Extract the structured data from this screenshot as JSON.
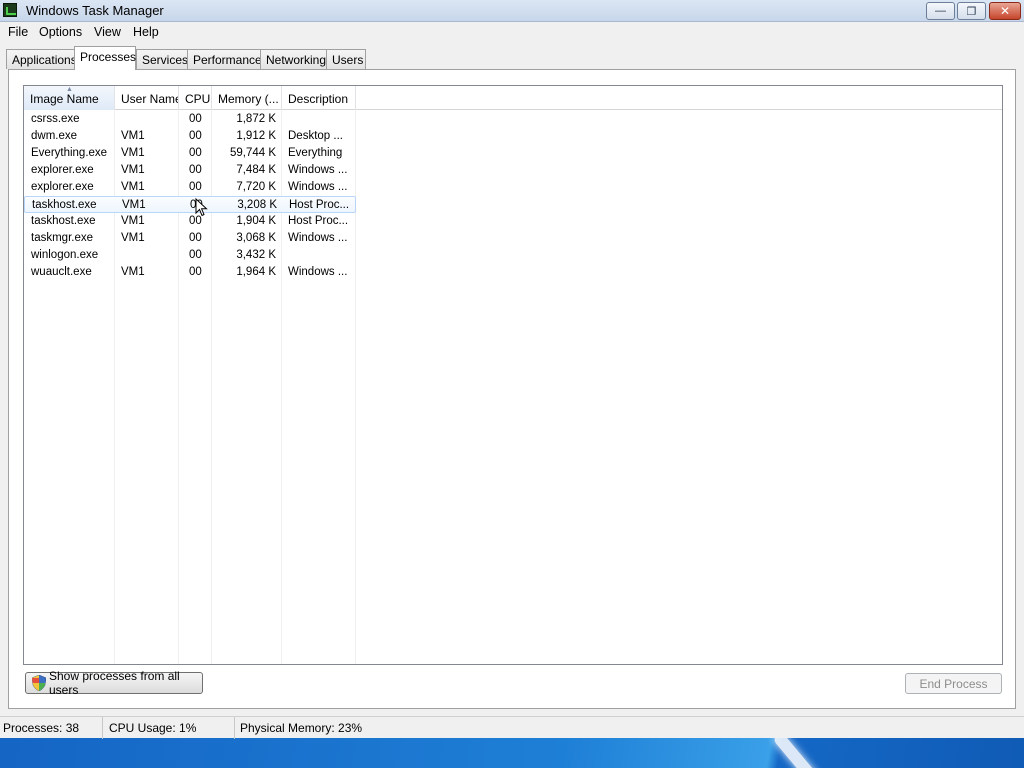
{
  "window": {
    "title": "Windows Task Manager",
    "buttons": {
      "minimize": "—",
      "maximize": "❐",
      "close": "✕"
    }
  },
  "menu": [
    "File",
    "Options",
    "View",
    "Help"
  ],
  "tabs": [
    "Applications",
    "Processes",
    "Services",
    "Performance",
    "Networking",
    "Users"
  ],
  "active_tab": "Processes",
  "table": {
    "columns": [
      "Image Name",
      "User Name",
      "CPU",
      "Memory (...",
      "Description"
    ],
    "rows": [
      {
        "name": "csrss.exe",
        "user": "",
        "cpu": "00",
        "memory": "1,872 K",
        "desc": ""
      },
      {
        "name": "dwm.exe",
        "user": "VM1",
        "cpu": "00",
        "memory": "1,912 K",
        "desc": "Desktop ..."
      },
      {
        "name": "Everything.exe",
        "user": "VM1",
        "cpu": "00",
        "memory": "59,744 K",
        "desc": "Everything"
      },
      {
        "name": "explorer.exe",
        "user": "VM1",
        "cpu": "00",
        "memory": "7,484 K",
        "desc": "Windows ..."
      },
      {
        "name": "explorer.exe",
        "user": "VM1",
        "cpu": "00",
        "memory": "7,720 K",
        "desc": "Windows ..."
      },
      {
        "name": "taskhost.exe",
        "user": "VM1",
        "cpu": "00",
        "memory": "3,208 K",
        "desc": "Host Proc..."
      },
      {
        "name": "taskhost.exe",
        "user": "VM1",
        "cpu": "00",
        "memory": "1,904 K",
        "desc": "Host Proc..."
      },
      {
        "name": "taskmgr.exe",
        "user": "VM1",
        "cpu": "00",
        "memory": "3,068 K",
        "desc": "Windows ..."
      },
      {
        "name": "winlogon.exe",
        "user": "",
        "cpu": "00",
        "memory": "3,432 K",
        "desc": ""
      },
      {
        "name": "wuauclt.exe",
        "user": "VM1",
        "cpu": "00",
        "memory": "1,964 K",
        "desc": "Windows ..."
      }
    ]
  },
  "buttons": {
    "show_all": "Show processes from all users",
    "end_process": "End Process"
  },
  "status": {
    "processes": "Processes: 38",
    "cpu": "CPU Usage: 1%",
    "memory": "Physical Memory: 23%"
  }
}
